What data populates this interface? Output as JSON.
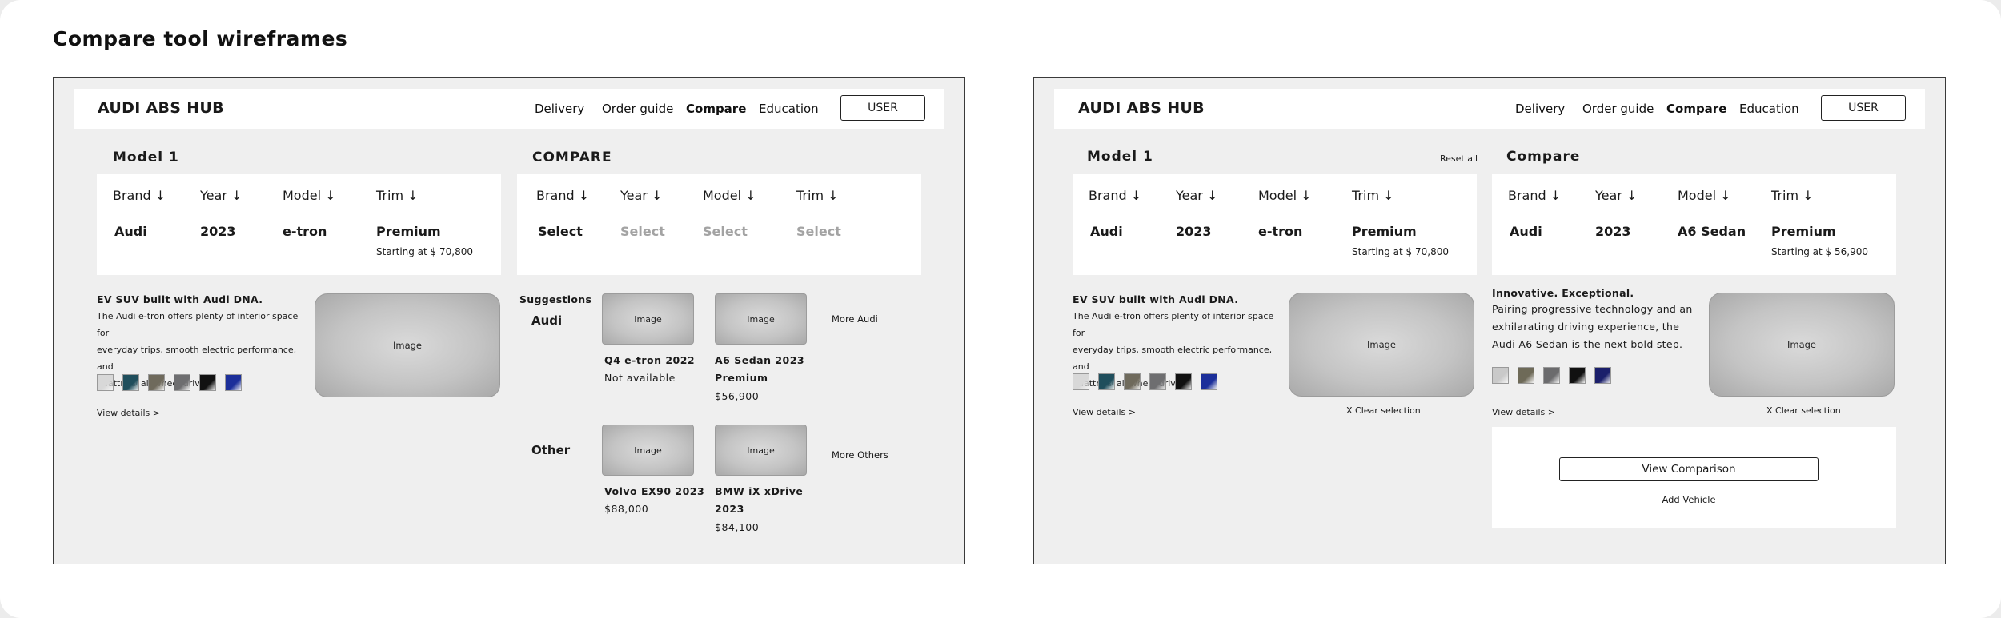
{
  "page": {
    "title": "Compare tool wireframes"
  },
  "frame1": {
    "nav": {
      "brand": "AUDI ABS HUB",
      "items": [
        "Delivery",
        "Order guide",
        "Compare",
        "Education"
      ],
      "user": "USER"
    },
    "model": {
      "title": "Model 1",
      "headers": [
        "Brand ↓",
        "Year ↓",
        "Model ↓",
        "Trim ↓"
      ],
      "values": [
        "Audi",
        "2023",
        "e-tron",
        "Premium"
      ],
      "price": "Starting at $ 70,800"
    },
    "compare": {
      "title": "COMPARE",
      "headers": [
        "Brand ↓",
        "Year ↓",
        "Model ↓",
        "Trim ↓"
      ],
      "values": [
        "Select",
        "Select",
        "Select",
        "Select"
      ]
    },
    "detail": {
      "title": "EV SUV built with Audi DNA.",
      "lines": [
        "The Audi e-tron offers plenty of interior space for",
        "everyday trips, smooth electric performance, and",
        "quattro® all-wheel drive."
      ],
      "image": "Image",
      "view_details": "View details >"
    },
    "suggestions": {
      "title": "Suggestions",
      "audi_label": "Audi",
      "other_label": "Other",
      "image": "Image",
      "more_audi": "More Audi",
      "more_others": "More Others",
      "audi": [
        {
          "name": "Q4 e-tron 2022",
          "sub": "Not available"
        },
        {
          "name_lines": [
            "A6 Sedan 2023",
            "Premium"
          ],
          "sub": "$56,900"
        }
      ],
      "other": [
        {
          "name": "Volvo EX90 2023",
          "sub": "$88,000"
        },
        {
          "name_lines": [
            "BMW iX xDrive",
            "2023"
          ],
          "sub": "$84,100"
        }
      ]
    }
  },
  "frame2": {
    "nav": {
      "brand": "AUDI ABS HUB",
      "items": [
        "Delivery",
        "Order guide",
        "Compare",
        "Education"
      ],
      "user": "USER"
    },
    "model": {
      "title": "Model 1",
      "reset": "Reset all",
      "headers": [
        "Brand ↓",
        "Year ↓",
        "Model ↓",
        "Trim ↓"
      ],
      "values": [
        "Audi",
        "2023",
        "e-tron",
        "Premium"
      ],
      "price": "Starting at $ 70,800"
    },
    "compare": {
      "title": "Compare",
      "headers": [
        "Brand ↓",
        "Year ↓",
        "Model ↓",
        "Trim ↓"
      ],
      "values": [
        "Audi",
        "2023",
        "A6 Sedan",
        "Premium"
      ],
      "price": "Starting at $ 56,900"
    },
    "detail_left": {
      "title": "EV SUV built with Audi DNA.",
      "lines": [
        "The Audi e-tron offers plenty of interior space for",
        "everyday trips, smooth electric performance, and",
        "quattro® all-wheel drive."
      ],
      "image": "Image",
      "view_details": "View details >",
      "clear": "X Clear selection"
    },
    "detail_right": {
      "title": "Innovative. Exceptional.",
      "lines": [
        "Pairing progressive technology and an",
        "exhilarating driving experience, the",
        "Audi A6 Sedan is the next bold step."
      ],
      "image": "Image",
      "view_details": "View details >",
      "clear": "X Clear selection"
    },
    "actions": {
      "view_comparison": "View Comparison",
      "add_vehicle": "Add Vehicle"
    }
  },
  "swatch_colors": {
    "etron": [
      "#d8d8d8",
      "#1f4e5c",
      "#6f6a5c",
      "#6e6e70",
      "#111111",
      "#1c2f9a"
    ],
    "a6": [
      "#c9c9c9",
      "#6e6a58",
      "#6b6b6d",
      "#111111",
      "#1b1f6b"
    ]
  }
}
